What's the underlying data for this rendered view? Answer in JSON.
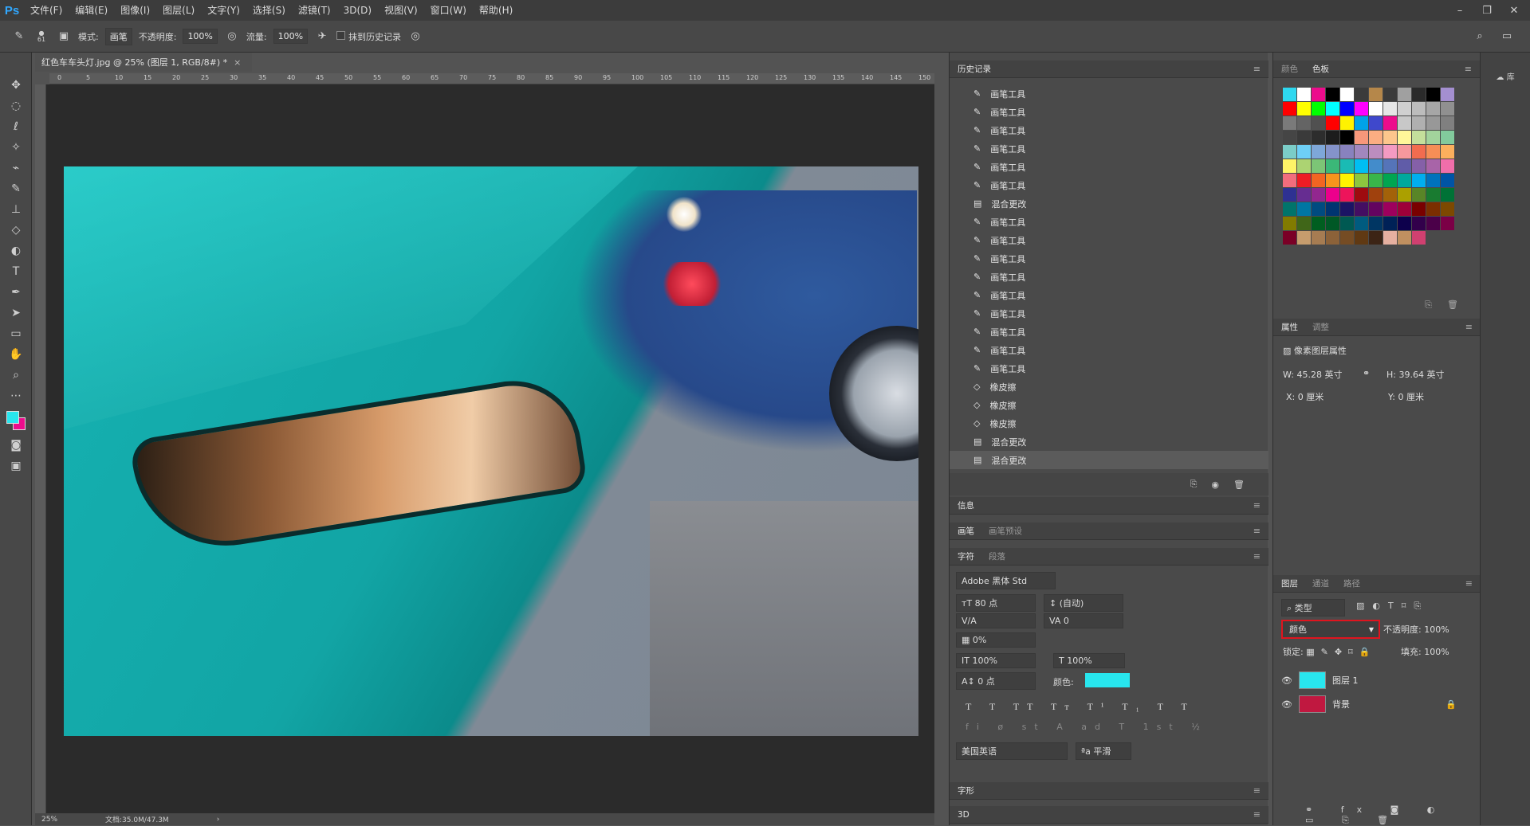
{
  "app": {
    "logo": "Ps"
  },
  "menu": [
    "文件(F)",
    "编辑(E)",
    "图像(I)",
    "图层(L)",
    "文字(Y)",
    "选择(S)",
    "滤镜(T)",
    "3D(D)",
    "视图(V)",
    "窗口(W)",
    "帮助(H)"
  ],
  "options": {
    "size": "61",
    "mode_label": "模式:",
    "mode_value": "画笔",
    "opacity_label": "不透明度:",
    "opacity_value": "100%",
    "flow_label": "流量:",
    "flow_value": "100%",
    "history_label": "抹到历史记录"
  },
  "document": {
    "tab_title": "红色车车头灯.jpg @ 25% (图层 1, RGB/8#) *",
    "zoom": "25%",
    "doc_size": "文档:35.0M/47.3M",
    "ruler_ticks": [
      "0",
      "5",
      "10",
      "15",
      "20",
      "25",
      "30",
      "35",
      "40",
      "45",
      "50",
      "55",
      "60",
      "65",
      "70",
      "75",
      "80",
      "85",
      "90",
      "95",
      "100",
      "105",
      "110",
      "115",
      "120",
      "125",
      "130",
      "135",
      "140",
      "145",
      "150"
    ]
  },
  "history": {
    "title": "历史记录",
    "items": [
      {
        "label": "画笔工具",
        "icon": "brush-icon"
      },
      {
        "label": "画笔工具",
        "icon": "brush-icon"
      },
      {
        "label": "画笔工具",
        "icon": "brush-icon"
      },
      {
        "label": "画笔工具",
        "icon": "brush-icon"
      },
      {
        "label": "画笔工具",
        "icon": "brush-icon"
      },
      {
        "label": "画笔工具",
        "icon": "brush-icon"
      },
      {
        "label": "混合更改",
        "icon": "blend-icon"
      },
      {
        "label": "画笔工具",
        "icon": "brush-icon"
      },
      {
        "label": "画笔工具",
        "icon": "brush-icon"
      },
      {
        "label": "画笔工具",
        "icon": "brush-icon"
      },
      {
        "label": "画笔工具",
        "icon": "brush-icon"
      },
      {
        "label": "画笔工具",
        "icon": "brush-icon"
      },
      {
        "label": "画笔工具",
        "icon": "brush-icon"
      },
      {
        "label": "画笔工具",
        "icon": "brush-icon"
      },
      {
        "label": "画笔工具",
        "icon": "brush-icon"
      },
      {
        "label": "画笔工具",
        "icon": "brush-icon"
      },
      {
        "label": "橡皮擦",
        "icon": "eraser-icon"
      },
      {
        "label": "橡皮擦",
        "icon": "eraser-icon"
      },
      {
        "label": "橡皮擦",
        "icon": "eraser-icon"
      },
      {
        "label": "混合更改",
        "icon": "blend-icon"
      },
      {
        "label": "混合更改",
        "icon": "blend-icon",
        "selected": true
      }
    ]
  },
  "panels": {
    "info": "信息",
    "brush": "画笔",
    "brush_preset": "画笔预设",
    "character": "字符",
    "paragraph": "段落",
    "glyphs": "字形",
    "three_d": "3D"
  },
  "character": {
    "font": "Adobe 黑体 Std",
    "size": "80 点",
    "leading": "(自动)",
    "kerning": "0",
    "tracking": "0%",
    "vscale": "100%",
    "hscale": "100%",
    "baseline": "0 点",
    "color_label": "颜色:",
    "color_hex": "#28e6ee",
    "language": "美国英语",
    "aa": "平滑"
  },
  "swatches": {
    "tabs": [
      "颜色",
      "色板"
    ],
    "colors": [
      "#2ed8f0",
      "#ffffff",
      "#ec0c8c",
      "#000000",
      "#ffffff",
      "#3b3b3b",
      "#b5874a",
      "#3b3b3b",
      "#a0a0a0",
      "#2a2a2a",
      "#000000",
      "#a48fd0",
      "#ff0000",
      "#ffff00",
      "#00ff00",
      "#00ffff",
      "#0000ff",
      "#ff00ff",
      "#ffffff",
      "#e6e6e6",
      "#d0d0d0",
      "#bcbcbc",
      "#a6a6a6",
      "#909090",
      "#7a7a7a",
      "#646464",
      "#505050",
      "#ff0000",
      "#fff200",
      "#00a2e8",
      "#3f48cc",
      "#ec0c8c",
      "#c8c8c8",
      "#b0b0b0",
      "#989898",
      "#808080",
      "#454545",
      "#3a3a3a",
      "#2d2d2d",
      "#1c1c1c",
      "#000000",
      "#f7977a",
      "#fbad82",
      "#fdc68c",
      "#fff799",
      "#c4df9b",
      "#a2d39c",
      "#82ca9c",
      "#7bcdc8",
      "#6ecff6",
      "#7ea7d8",
      "#8493ca",
      "#8882be",
      "#a187be",
      "#bc8dbf",
      "#f49ac2",
      "#f6989d",
      "#f26c4f",
      "#f68e56",
      "#fbaf5d",
      "#fff467",
      "#acd372",
      "#7cc576",
      "#3bb878",
      "#1abbb4",
      "#00bff3",
      "#438ccb",
      "#5574b9",
      "#605ca8",
      "#8560a8",
      "#a864a8",
      "#f06eaa",
      "#f26d7d",
      "#ed1c24",
      "#f26522",
      "#f7941d",
      "#fff200",
      "#8dc63f",
      "#39b54a",
      "#00a651",
      "#00a99d",
      "#00aeef",
      "#0072bc",
      "#0054a6",
      "#2e3192",
      "#662d91",
      "#92278f",
      "#ec008c",
      "#ed145b",
      "#9e0b0f",
      "#a0410d",
      "#a36209",
      "#aba000",
      "#598527",
      "#197b30",
      "#007236",
      "#00746b",
      "#0076a3",
      "#004b80",
      "#003471",
      "#1b1464",
      "#440e62",
      "#630460",
      "#9e005d",
      "#9e0039",
      "#790000",
      "#7b2e00",
      "#7d4900",
      "#827b00",
      "#406618",
      "#005e20",
      "#005826",
      "#005952",
      "#005b7f",
      "#003663",
      "#002157",
      "#0d004c",
      "#32004b",
      "#4b0049",
      "#7b0046",
      "#7a0026",
      "#c69c6d",
      "#a67c52",
      "#8c6239",
      "#754c24",
      "#603913",
      "#3c2415",
      "#e6b0a0",
      "#c09060",
      "#d04070"
    ]
  },
  "properties": {
    "tabs": [
      "属性",
      "调整"
    ],
    "type": "像素图层属性",
    "w_label": "W:",
    "w": "45.28 英寸",
    "h_label": "H:",
    "h": "39.64 英寸",
    "x_label": "X:",
    "x": "0 厘米",
    "y_label": "Y:",
    "y": "0 厘米"
  },
  "layers": {
    "tabs": [
      "图层",
      "通道",
      "路径"
    ],
    "filter": "类型",
    "blend_mode": "颜色",
    "opacity_label": "不透明度:",
    "opacity": "100%",
    "lock_label": "锁定:",
    "fill_label": "填充:",
    "fill": "100%",
    "items": [
      {
        "name": "图层 1",
        "thumb": "#28e6ee"
      },
      {
        "name": "背景",
        "thumb": "#c01840"
      }
    ]
  },
  "libraries": {
    "label": "库"
  }
}
